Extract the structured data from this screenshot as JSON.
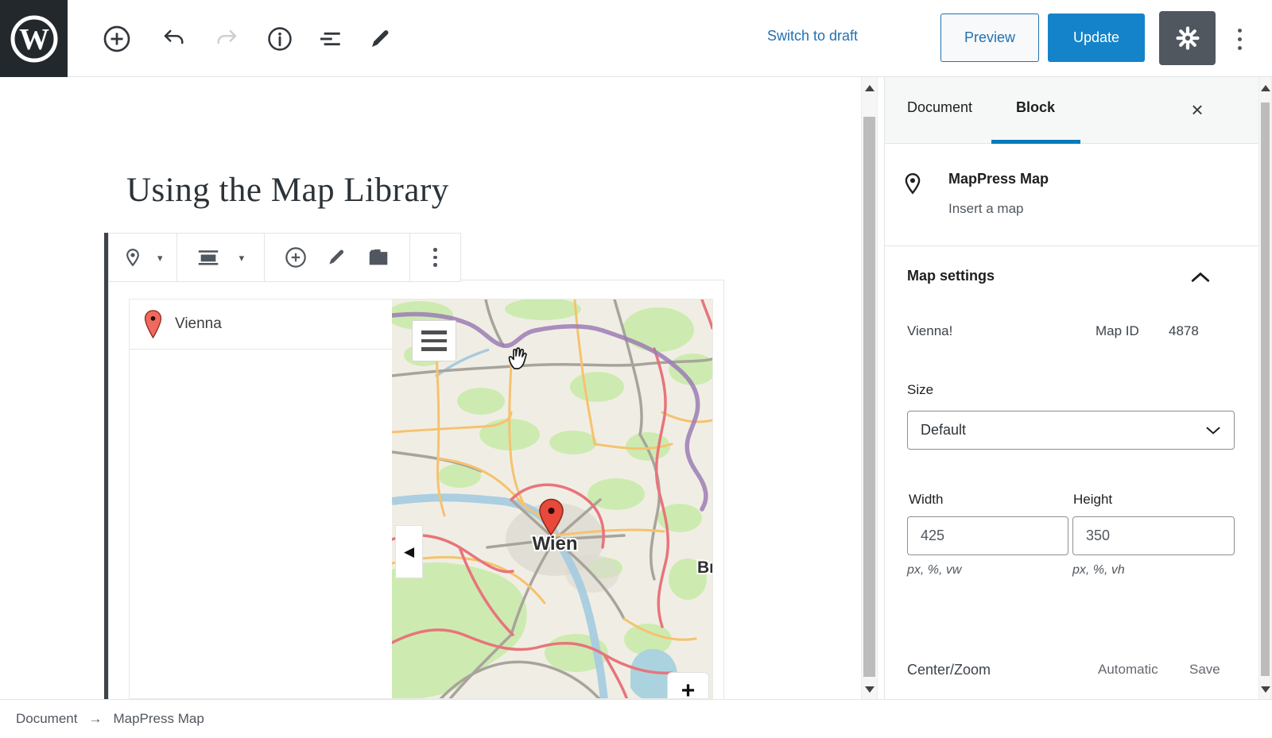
{
  "header": {
    "switch_to_draft": "Switch to draft",
    "preview": "Preview",
    "update": "Update"
  },
  "document": {
    "title": "Using the Map Library"
  },
  "map_block": {
    "marker_item": "Vienna",
    "map": {
      "city_label": "Wien",
      "edge_label": "Br"
    }
  },
  "sidebar": {
    "tabs": [
      {
        "label": "Document"
      },
      {
        "label": "Block"
      }
    ],
    "block_card": {
      "title": "MapPress Map",
      "description": "Insert a map"
    },
    "map_settings": {
      "heading": "Map settings",
      "map_name": "Vienna!",
      "map_id_label": "Map ID",
      "map_id": "4878",
      "size_label": "Size",
      "size_value": "Default",
      "width_label": "Width",
      "width_value": "425",
      "width_hint": "px, %, vw",
      "height_label": "Height",
      "height_value": "350",
      "height_hint": "px, %, vh",
      "center_zoom_label": "Center/Zoom",
      "automatic_label": "Automatic",
      "save_label": "Save"
    }
  },
  "footer": {
    "breadcrumb_root": "Document",
    "breadcrumb_arrow": "→",
    "breadcrumb_current": "MapPress Map"
  },
  "glyphs": {
    "wordpress_w": "W",
    "caret_down": "▾",
    "left_arrow": "◀",
    "plus": "+",
    "close": "×"
  },
  "colors": {
    "accent_blue": "#007cba",
    "update_button": "#1483c9",
    "marker_red": "#e8493a",
    "toolbar_icon": "#50575e"
  }
}
